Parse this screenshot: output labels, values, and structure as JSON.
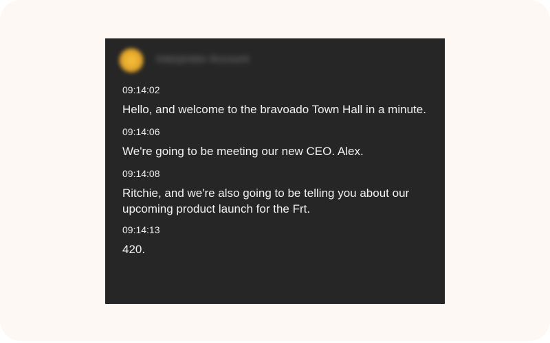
{
  "transcript": {
    "speaker_name": "Interpreter Account",
    "entries": [
      {
        "time": "09:14:02",
        "text": "Hello, and welcome to the bravoado Town Hall in a minute."
      },
      {
        "time": "09:14:06",
        "text": "We're going to be meeting our new CEO. Alex."
      },
      {
        "time": "09:14:08",
        "text": "Ritchie, and we're also going to be telling you about our upcoming product launch for the Frt."
      },
      {
        "time": "09:14:13",
        "text": "420."
      }
    ]
  },
  "colors": {
    "panel_background": "#262626",
    "frame_background": "#fdf8f4",
    "avatar": "#f0b733",
    "text": "#f2f2f2"
  },
  "icons": {
    "avatar": "user-avatar-icon"
  }
}
